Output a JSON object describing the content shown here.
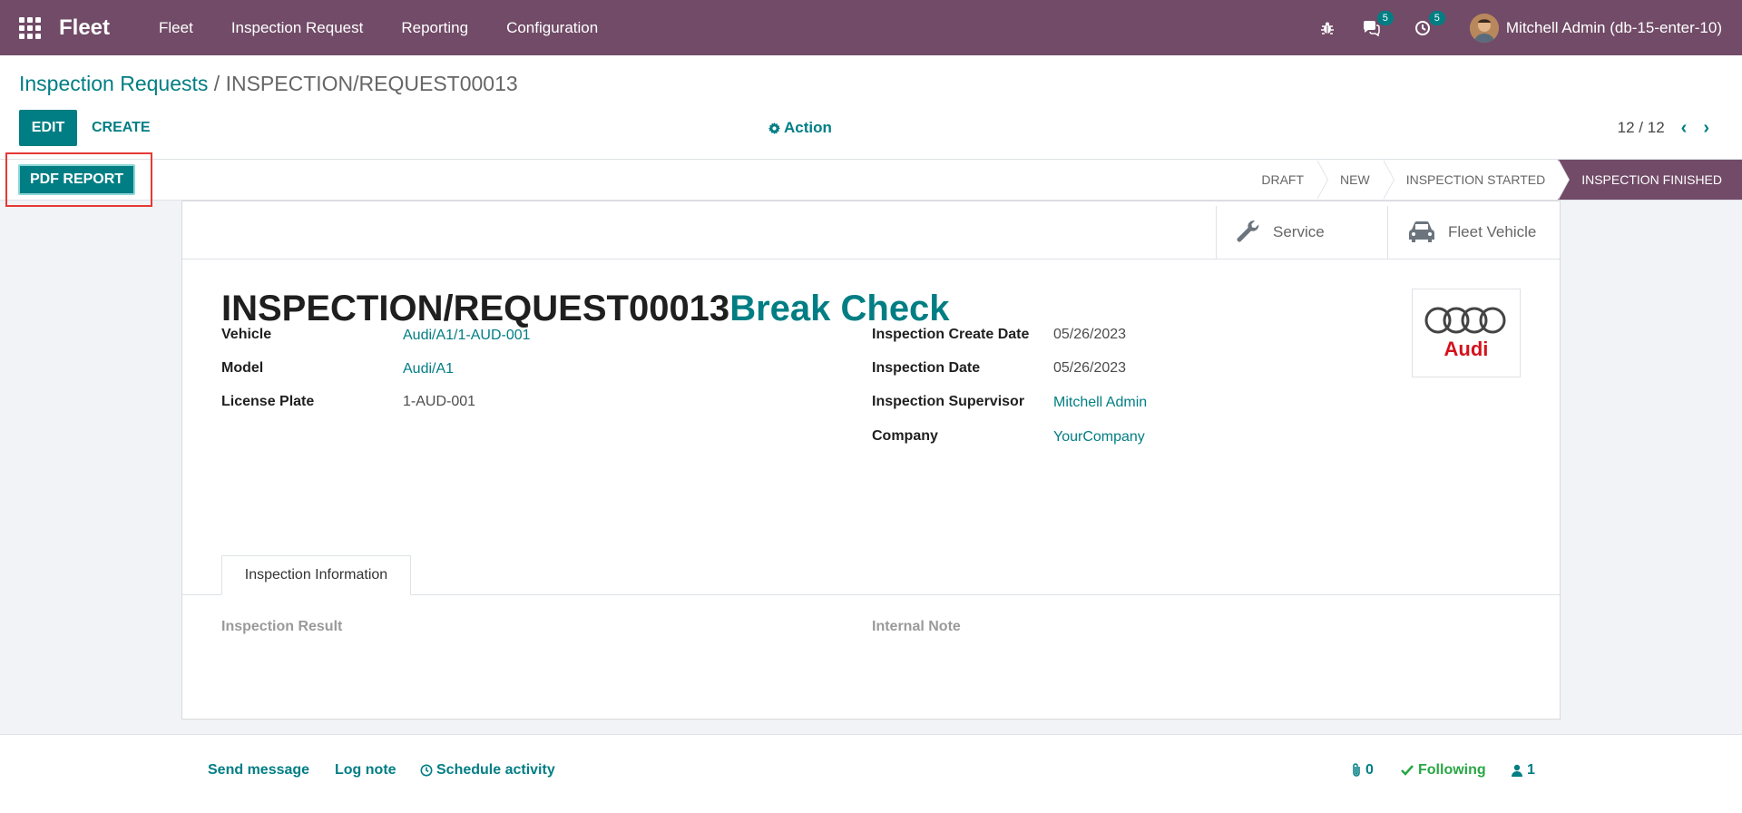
{
  "nav": {
    "brand": "Fleet",
    "menu": [
      "Fleet",
      "Inspection Request",
      "Reporting",
      "Configuration"
    ],
    "messages_count": "5",
    "activities_count": "5",
    "user": "Mitchell Admin (db-15-enter-10)"
  },
  "control": {
    "breadcrumb_parent": "Inspection Requests",
    "breadcrumb_sep": " / ",
    "breadcrumb_current": "INSPECTION/REQUEST00013",
    "edit_label": "EDIT",
    "create_label": "CREATE",
    "action_label": "Action",
    "pager": "12 / 12"
  },
  "statusbar": {
    "pdf_label": "PDF REPORT",
    "stages": [
      "DRAFT",
      "NEW",
      "INSPECTION STARTED",
      "INSPECTION FINISHED"
    ],
    "active_stage": "INSPECTION FINISHED"
  },
  "smart_buttons": {
    "service": "Service",
    "fleet_vehicle": "Fleet Vehicle"
  },
  "form": {
    "reference": "INSPECTION/REQUEST00013",
    "name": "Break Check",
    "logo_text": "Audi",
    "left_fields": [
      {
        "label": "Vehicle",
        "value": "Audi/A1/1-AUD-001"
      },
      {
        "label": "Model",
        "value": "Audi/A1"
      },
      {
        "label": "License Plate",
        "value": "1-AUD-001"
      }
    ],
    "right_fields": [
      {
        "label": "Inspection Create Date",
        "value": "05/26/2023"
      },
      {
        "label": "Inspection Date",
        "value": "05/26/2023"
      },
      {
        "label": "Inspection Supervisor",
        "value": "Mitchell Admin"
      },
      {
        "label": "Company",
        "value": "YourCompany"
      }
    ],
    "tab_label": "Inspection Information",
    "inspection_result_label": "Inspection Result",
    "internal_note_label": "Internal Note"
  },
  "chatter": {
    "send_message": "Send message",
    "log_note": "Log note",
    "schedule_activity": "Schedule activity",
    "attachments": "0",
    "following": "Following",
    "followers": "1"
  },
  "colors": {
    "nav_bg": "#714b67",
    "accent": "#017e84",
    "follow_green": "#28a745"
  }
}
